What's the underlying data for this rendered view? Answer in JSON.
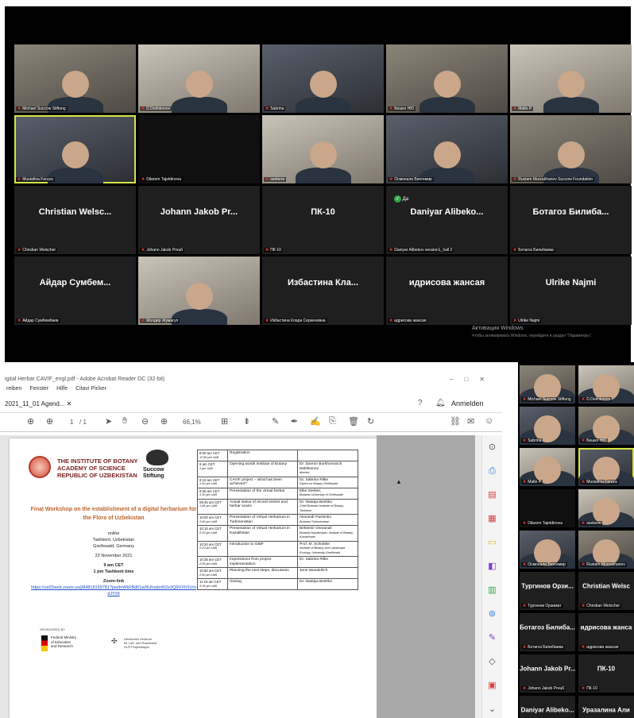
{
  "zoom_top": {
    "tiles": [
      {
        "label": "Michael Succow Stiftung",
        "kind": "video"
      },
      {
        "label": "D.Dekhkonov",
        "kind": "video"
      },
      {
        "label": "Sabrina",
        "kind": "video"
      },
      {
        "label": "Бешко НЮ",
        "kind": "video"
      },
      {
        "label": "Malte P",
        "kind": "video"
      },
      {
        "label": "Mustafina Feruza",
        "kind": "video"
      },
      {
        "label": "Dilarom Tajetdinova",
        "kind": "dark"
      },
      {
        "label": "seebere",
        "kind": "video"
      },
      {
        "label": "Осмонали Бектемир",
        "kind": "video"
      },
      {
        "label": "Rustam Murzakhanov Succow Foundation",
        "kind": "video"
      },
      {
        "name": "Christian Welsc...",
        "label": "Christian Welscher",
        "kind": "name"
      },
      {
        "name": "Johann Jakob Pr...",
        "label": "Johann Jakob Preuß",
        "kind": "name"
      },
      {
        "name": "ПК-10",
        "label": "ПК-10",
        "kind": "name"
      },
      {
        "name": "Daniyar Alibeko...",
        "label": "Daniyar Alibekov session1_hall 2",
        "kind": "name"
      },
      {
        "name": "Ботагоз Билиба...",
        "label": "Ботагоз Билибаева",
        "kind": "name"
      },
      {
        "name": "Айдар Сумбем...",
        "label": "Айдар Сумбембаев",
        "kind": "name"
      },
      {
        "label": "Молдир Жумагул",
        "kind": "video"
      },
      {
        "name": "Избастина Кла...",
        "label": "Избастина Клара Серкеновна",
        "kind": "name"
      },
      {
        "name": "идрисова жансая",
        "label": "идрисова жансая",
        "kind": "name"
      },
      {
        "name": "Ulrike Najmi",
        "label": "Ulrike Najmi",
        "kind": "name"
      }
    ],
    "reaction_text": "Да",
    "windows_activation": "Активация Windows",
    "windows_activation_hint": "Чтобы активировать Windows, перейдите в раздел \"Параметры\"."
  },
  "acrobat": {
    "title": "igital Herbar CAVIF_engl.pdf - Adobe Acrobat Reader DC (32-bit)",
    "menu": [
      "reiben",
      "Fenster",
      "Hilfe",
      "Citavi Picker"
    ],
    "tab": "2021_11_01 Agend...",
    "sign_in": "Anmelden",
    "page_current": "1",
    "page_total": "/ 1",
    "zoom": "66,1%"
  },
  "doc": {
    "institute": [
      "THE INSTITUTE OF BOTANY",
      "ACADEMY OF SCIENCE",
      "REPUBLIC OF UZBEKISTAN"
    ],
    "succow": [
      "Succow",
      "Stiftung"
    ],
    "workshop_title": "Final Workshop on the establishment of a digital herbarium for the Flora of Uzbekistan",
    "online": "online",
    "city1": "Tashkent, Uzbekistan",
    "city2": "Greifswald, Germany",
    "date": "23 November 2021",
    "time1": "9 am CET",
    "time2": "1 pm Tashkent time",
    "zoom_link_label": "Zoom-link",
    "zoom_link": "https://us02web.zoom.us/j/84818159781?pwd=WkFBd01wNUhsdzd02e3Q0VXhSVmdJT09",
    "sponsored": "SPONSORED BY",
    "bmbf": [
      "Federal Ministry",
      "of Education",
      "and Research"
    ],
    "dlr": [
      "Deutsches Zentrum",
      "für Luft- und Raumfahrt",
      "DLR Projektträger"
    ],
    "agenda": [
      {
        "t1": "8:50 am CET",
        "t2": "12:50 pm UzB",
        "s": "Registration",
        "p": "",
        "r": ""
      },
      {
        "t1": "9 am CET",
        "t2": "1 pm UzB",
        "s": "Opening words Institute of Botany",
        "p": "Dr. Davron Burkhonovich Dekhkonov",
        "r": "director"
      },
      {
        "t1": "9:10 am CET",
        "t2": "1:10 pm UzB",
        "s": "CAVIF project – what has been achieved?",
        "p": "Dr. Sabrina Rilke",
        "r": "Expert on Botany Greifswald"
      },
      {
        "t1": "9:30 am CET",
        "t2": "1:30 pm UzB",
        "s": "Presentation of the virtual herbar",
        "p": "Elke Seeber,",
        "r": "Botanist University of Greifswald"
      },
      {
        "t1": "09:45 am CET",
        "t2": "1:45 pm UzB",
        "s": "Actual status of record entries and herbar scans",
        "p": "Dr. Natalya Beshko",
        "r": "Chief Botanist Institute of Botany, Tashkent"
      },
      {
        "t1": "10:00 am CET",
        "t2": "2:00 pm UzB",
        "s": "Presentation of Virtual Herbarium in Turkmenistan",
        "p": "Alexandr Pavlenko",
        "r": "Botanist Turkmenistan"
      },
      {
        "t1": "10:10 am CET",
        "t2": "2:10 pm UzB",
        "s": "Presentation of Virtual Herbarium in Kazakhstan",
        "p": "Bektemir Osmanali",
        "r": "Botanist Kazakhstan, Institute of Botany, Kazakhstan"
      },
      {
        "t1": "10:20 am CET",
        "t2": "2:20 pm UzB",
        "s": "Introduction to GBIF",
        "p": "Prof. M. Schnittler",
        "r": "Institute of Botany and Landscape Ecology, University Greifswald"
      },
      {
        "t1": "10:35 am CET",
        "t2": "2:35 pm UzB",
        "s": "Impressions from project implementation",
        "p": "Dr. Sabrina Rilke",
        "r": ""
      },
      {
        "t1": "10:50 am CET",
        "t2": "2:50 pm UzB",
        "s": "Planning the next steps, discussion",
        "p": "Jens Wunderlich",
        "r": ""
      },
      {
        "t1": "11:15 am CET",
        "t2": "3:15 pm UzB",
        "s": "closing",
        "p": "Dr. Natalya Beshko",
        "r": ""
      }
    ]
  },
  "zoom_side": {
    "tiles": [
      {
        "label": "Michael Succow Stiftung",
        "kind": "video"
      },
      {
        "label": "D.Dekhkonov",
        "kind": "video"
      },
      {
        "label": "Sabrina",
        "kind": "video"
      },
      {
        "label": "Бешко НЮ",
        "kind": "video"
      },
      {
        "label": "Malte P",
        "kind": "video"
      },
      {
        "label": "Mustafina Feruza",
        "kind": "video"
      },
      {
        "label": "Dilarom Tajetdinova",
        "kind": "dark"
      },
      {
        "label": "seebere",
        "kind": "video"
      },
      {
        "label": "Осмонали Бектемир",
        "kind": "video"
      },
      {
        "label": "Rustam Murzakhanov",
        "kind": "video"
      },
      {
        "name": "Тургинов Орзи...",
        "label": "Тургинов Орзимат",
        "kind": "name"
      },
      {
        "name": "Christian Welsc",
        "label": "Christian Welscher",
        "kind": "name"
      },
      {
        "name": "Ботагоз Билиба...",
        "label": "Ботагоз Билибаева",
        "kind": "name"
      },
      {
        "name": "идрисова жанса",
        "label": "идрисова жансая",
        "kind": "name"
      },
      {
        "name": "Johann Jakob Pr...",
        "label": "Johann Jakob Preuß",
        "kind": "name"
      },
      {
        "name": "ПК-10",
        "label": "ПК-10",
        "kind": "name"
      },
      {
        "name": "Daniyar Alibeko...",
        "label": "",
        "kind": "name"
      },
      {
        "name": "Уразалина Али",
        "label": "",
        "kind": "name"
      }
    ]
  }
}
